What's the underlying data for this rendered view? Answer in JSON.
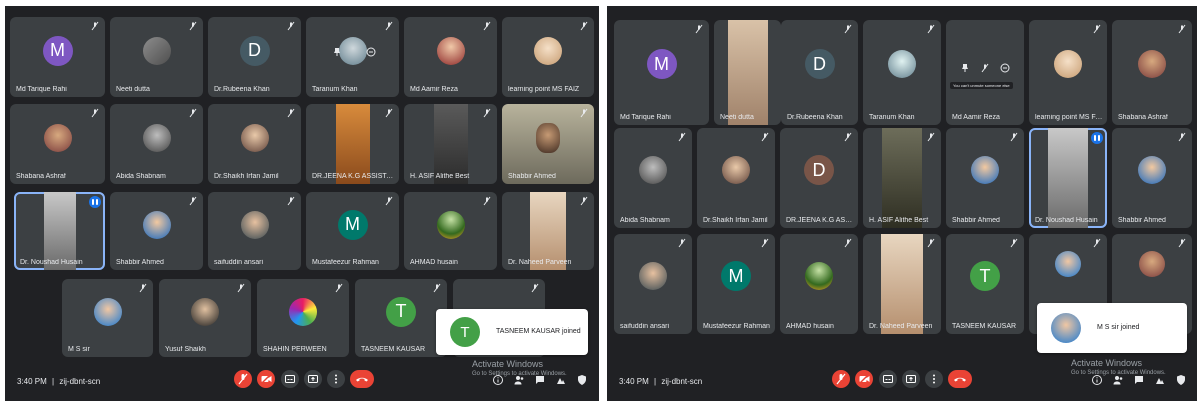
{
  "left": {
    "tiles": [
      {
        "name": "Md Tarique Rahi",
        "letter": "M",
        "color": "#7e57c2"
      },
      {
        "name": "Neeti dutta"
      },
      {
        "name": "Dr.Rubeena Khan",
        "letter": "D",
        "color": "#455a64"
      },
      {
        "name": "Taranum Khan"
      },
      {
        "name": "Md Aamir Reza"
      },
      {
        "name": "learning point MS FAIZ"
      },
      {
        "name": "Shabana Ashraf"
      },
      {
        "name": "Abida Shabnam"
      },
      {
        "name": "Dr.Shaikh Irfan Jamil"
      },
      {
        "name": "DR.JEENA K.G ASSISTAN..."
      },
      {
        "name": "H. ASIF Alithe Best"
      },
      {
        "name": "Shabbir Ahmed"
      },
      {
        "name": "Dr. Noushad Husain"
      },
      {
        "name": "Shabbir Ahmed"
      },
      {
        "name": "saifuddin ansari"
      },
      {
        "name": "Mustafeezur Rahman",
        "letter": "M",
        "color": "#00796b"
      },
      {
        "name": "AHMAD husain"
      },
      {
        "name": "Dr. Naheed Parveen"
      },
      {
        "name": "M S sir"
      },
      {
        "name": "Yusuf Shaikh"
      },
      {
        "name": "SHAHIN PERWEEN"
      },
      {
        "name": "TASNEEM KAUSAR",
        "letter": "T",
        "color": "#43a047"
      },
      {
        "name": ""
      }
    ],
    "time": "3:40 PM",
    "separator": "|",
    "code": "zij-dbnt-scn",
    "toast": {
      "text": "TASNEEM KAUSAR joined",
      "letter": "T",
      "color": "#43a047"
    },
    "activate": {
      "title": "Activate Windows",
      "sub": "Go to Settings to activate Windows."
    }
  },
  "right": {
    "tiles": [
      {
        "name": "Md Tarique Rahi",
        "letter": "M",
        "color": "#7e57c2"
      },
      {
        "name": "Neeti dutta"
      },
      {
        "name": "Dr.Rubeena Khan",
        "letter": "D",
        "color": "#455a64"
      },
      {
        "name": "Taranum Khan"
      },
      {
        "name": "Md Aamir Reza",
        "tooltip": "You can't unmute someone else"
      },
      {
        "name": "learning point MS FAIZ"
      },
      {
        "name": "Shabana Ashraf"
      },
      {
        "name": "Abida Shabnam"
      },
      {
        "name": "Dr.Shaikh Irfan Jamil"
      },
      {
        "name": "DR.JEENA K.G ASSIST...",
        "letter": "D",
        "color": "#795548"
      },
      {
        "name": "H. ASIF Alithe Best"
      },
      {
        "name": "Shabbir Ahmed"
      },
      {
        "name": "Dr. Noushad Husain"
      },
      {
        "name": "Shabbir Ahmed"
      },
      {
        "name": "saifuddin ansari"
      },
      {
        "name": "Mustafeezur Rahman",
        "letter": "M",
        "color": "#00796b"
      },
      {
        "name": "AHMAD husain"
      },
      {
        "name": "Dr. Naheed Parveen"
      },
      {
        "name": "TASNEEM KAUSAR",
        "letter": "T",
        "color": "#43a047"
      },
      {
        "name": ""
      },
      {
        "name": ""
      }
    ],
    "time": "3:40 PM",
    "separator": "|",
    "code": "zij-dbnt-scn",
    "toast": {
      "text": "M S sir joined"
    },
    "activate": {
      "title": "Activate Windows",
      "sub": "Go to Settings to activate Windows."
    }
  },
  "colors": {
    "bg": "#202124",
    "tile": "#3c4043",
    "red": "#ea4335",
    "speaking": "#8ab4f8"
  },
  "icons": [
    "mic-off-icon",
    "camera-off-icon",
    "captions-icon",
    "present-icon",
    "more-options-icon",
    "hang-up-icon",
    "info-icon",
    "people-icon",
    "chat-icon",
    "activities-icon",
    "host-controls-icon",
    "speaking-indicator-icon"
  ]
}
